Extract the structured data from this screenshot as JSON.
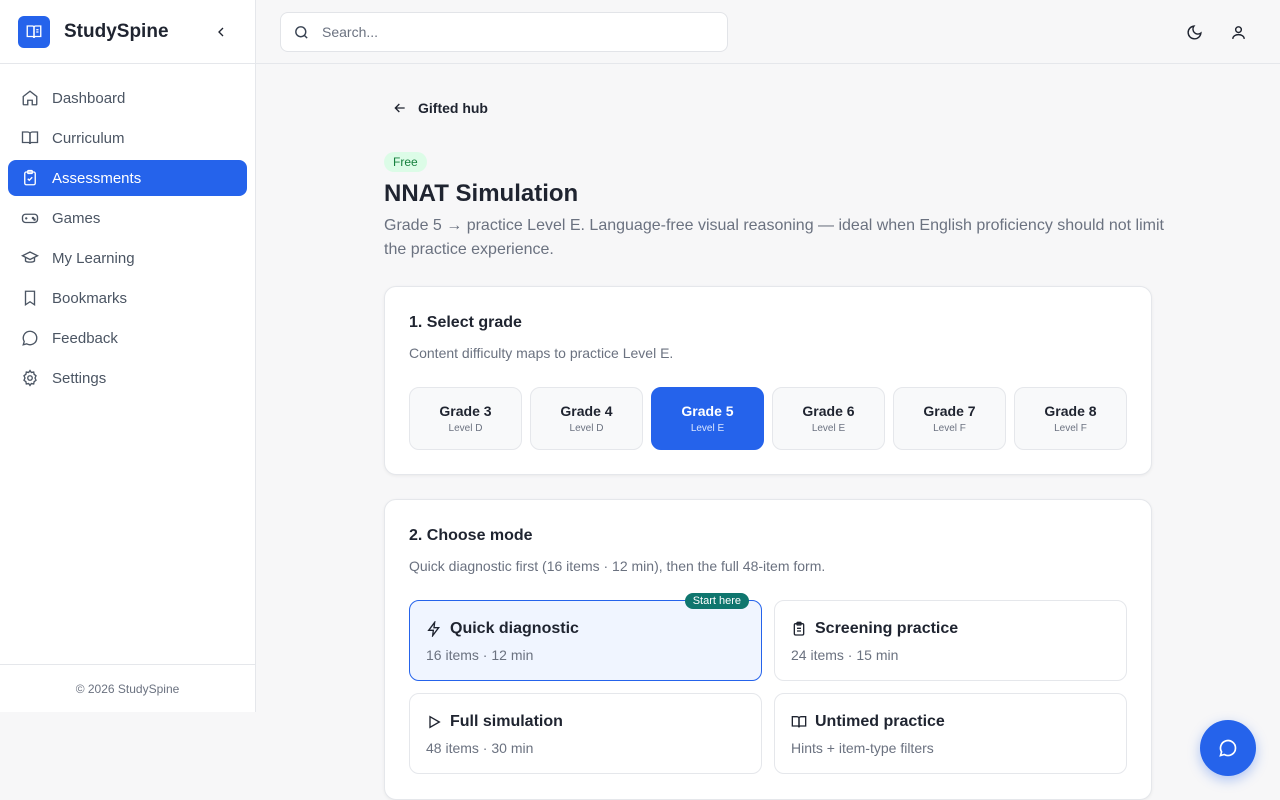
{
  "app": {
    "name": "StudySpine"
  },
  "sidebar": {
    "items": [
      {
        "label": "Dashboard",
        "icon": "home-icon"
      },
      {
        "label": "Curriculum",
        "icon": "book-icon"
      },
      {
        "label": "Assessments",
        "icon": "clipboard-check-icon",
        "active": true
      },
      {
        "label": "Games",
        "icon": "gamepad-icon"
      },
      {
        "label": "My Learning",
        "icon": "graduation-cap-icon"
      },
      {
        "label": "Bookmarks",
        "icon": "bookmark-icon"
      },
      {
        "label": "Feedback",
        "icon": "message-circle-icon"
      },
      {
        "label": "Settings",
        "icon": "gear-icon"
      }
    ],
    "footer": "© 2026 StudySpine"
  },
  "header": {
    "search_placeholder": "Search..."
  },
  "main": {
    "back_label": "Gifted hub",
    "badge": "Free",
    "title": "NNAT Simulation",
    "description": "Grade 5 → practice Level E. Language-free visual reasoning — ideal when English proficiency should not limit the practice experience.",
    "grade_section": {
      "title": "1. Select grade",
      "subtitle": "Content difficulty maps to practice Level E.",
      "grades": [
        {
          "grade": "Grade 3",
          "level": "Level D"
        },
        {
          "grade": "Grade 4",
          "level": "Level D"
        },
        {
          "grade": "Grade 5",
          "level": "Level E",
          "selected": true
        },
        {
          "grade": "Grade 6",
          "level": "Level E"
        },
        {
          "grade": "Grade 7",
          "level": "Level F"
        },
        {
          "grade": "Grade 8",
          "level": "Level F"
        }
      ]
    },
    "mode_section": {
      "title": "2. Choose mode",
      "subtitle": "Quick diagnostic first (16 items · 12 min), then the full 48-item form.",
      "modes": [
        {
          "title": "Quick diagnostic",
          "detail": "16 items · 12 min",
          "icon": "lightning-icon",
          "tag": "Start here"
        },
        {
          "title": "Screening practice",
          "detail": "24 items · 15 min",
          "icon": "clipboard-icon"
        },
        {
          "title": "Full simulation",
          "detail": "48 items · 30 min",
          "icon": "play-icon"
        },
        {
          "title": "Untimed practice",
          "detail": "Hints + item-type filters",
          "icon": "open-book-icon"
        }
      ]
    }
  },
  "colors": {
    "accent": "#2563eb",
    "free_badge_bg": "#dcfce7",
    "free_badge_text": "#15803d",
    "start_tag": "#0f766e"
  }
}
